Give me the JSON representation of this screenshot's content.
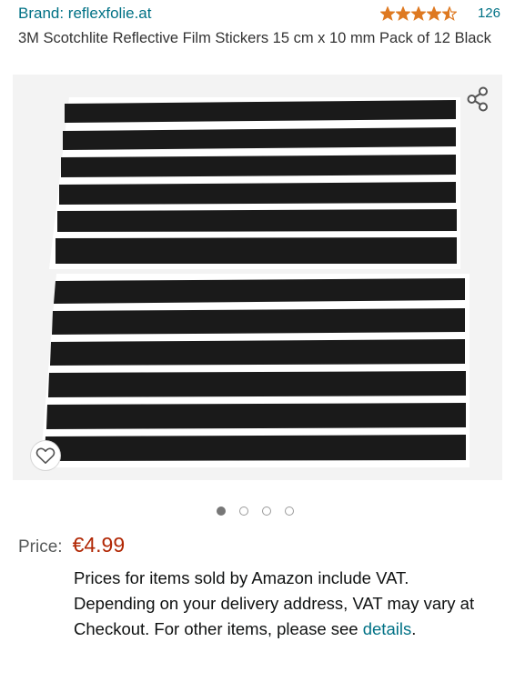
{
  "header": {
    "brand": "Brand: reflexfolie.at",
    "rating_value": 4.5,
    "rating_max": 5,
    "review_count": "126",
    "star_color": "#de7921"
  },
  "product": {
    "title": "3M Scotchlite Reflective Film Stickers 15 cm x 10 mm Pack of 12 Black"
  },
  "gallery": {
    "share_icon": "share-icon",
    "wishlist_icon": "heart-icon",
    "image_count": 4,
    "active_index": 0
  },
  "price": {
    "label": "Price:",
    "value": "€4.99",
    "color": "#b12704"
  },
  "vat_note": {
    "text": "Prices for items sold by Amazon include VAT. Depending on your delivery address, VAT may vary at Checkout. For other items, please see ",
    "link": "details",
    "suffix": "."
  },
  "colors": {
    "link": "#007185",
    "text": "#0f1111"
  }
}
